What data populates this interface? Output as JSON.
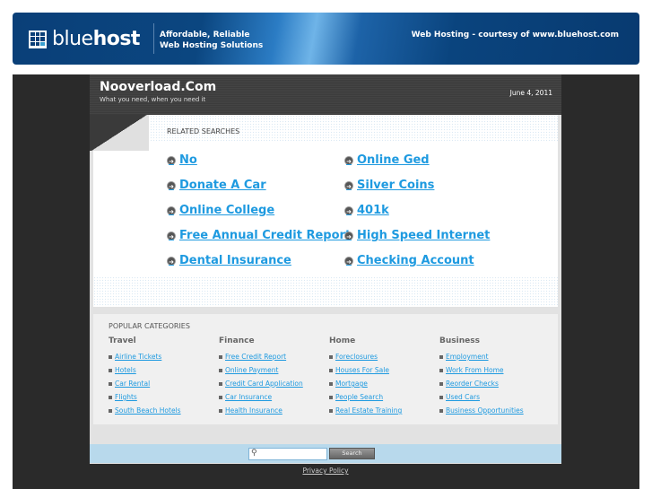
{
  "banner": {
    "logo_text_light": "blue",
    "logo_text_bold": "host",
    "tagline_1": "Affordable, Reliable",
    "tagline_2": "Web Hosting Solutions",
    "courtesy": "Web Hosting - courtesy of www.bluehost.com"
  },
  "header": {
    "title": "Nooverload.Com",
    "subtitle": "What you need, when you need it",
    "date": "June 4, 2011"
  },
  "related": {
    "title": "RELATED SEARCHES",
    "links": [
      "No",
      "Donate A Car",
      "Online College",
      "Free Annual Credit Report",
      "Dental Insurance",
      "Online Ged",
      "Silver Coins",
      "401k",
      "High Speed Internet",
      "Checking Account"
    ]
  },
  "popular": {
    "title": "POPULAR CATEGORIES",
    "columns": [
      {
        "heading": "Travel",
        "items": [
          "Airline Tickets",
          "Hotels",
          "Car Rental",
          "Flights",
          "South Beach Hotels"
        ]
      },
      {
        "heading": "Finance",
        "items": [
          "Free Credit Report",
          "Online Payment",
          "Credit Card Application",
          "Car Insurance",
          "Health Insurance"
        ]
      },
      {
        "heading": "Home",
        "items": [
          "Foreclosures",
          "Houses For Sale",
          "Mortgage",
          "People Search",
          "Real Estate Training"
        ]
      },
      {
        "heading": "Business",
        "items": [
          "Employment",
          "Work From Home",
          "Reorder Checks",
          "Used Cars",
          "Business Opportunities"
        ]
      }
    ]
  },
  "search": {
    "button": "Search",
    "value": ""
  },
  "footer": {
    "privacy": "Privacy Policy"
  },
  "colors": {
    "link": "#1e9ae0",
    "banner": "#0a3f78"
  }
}
